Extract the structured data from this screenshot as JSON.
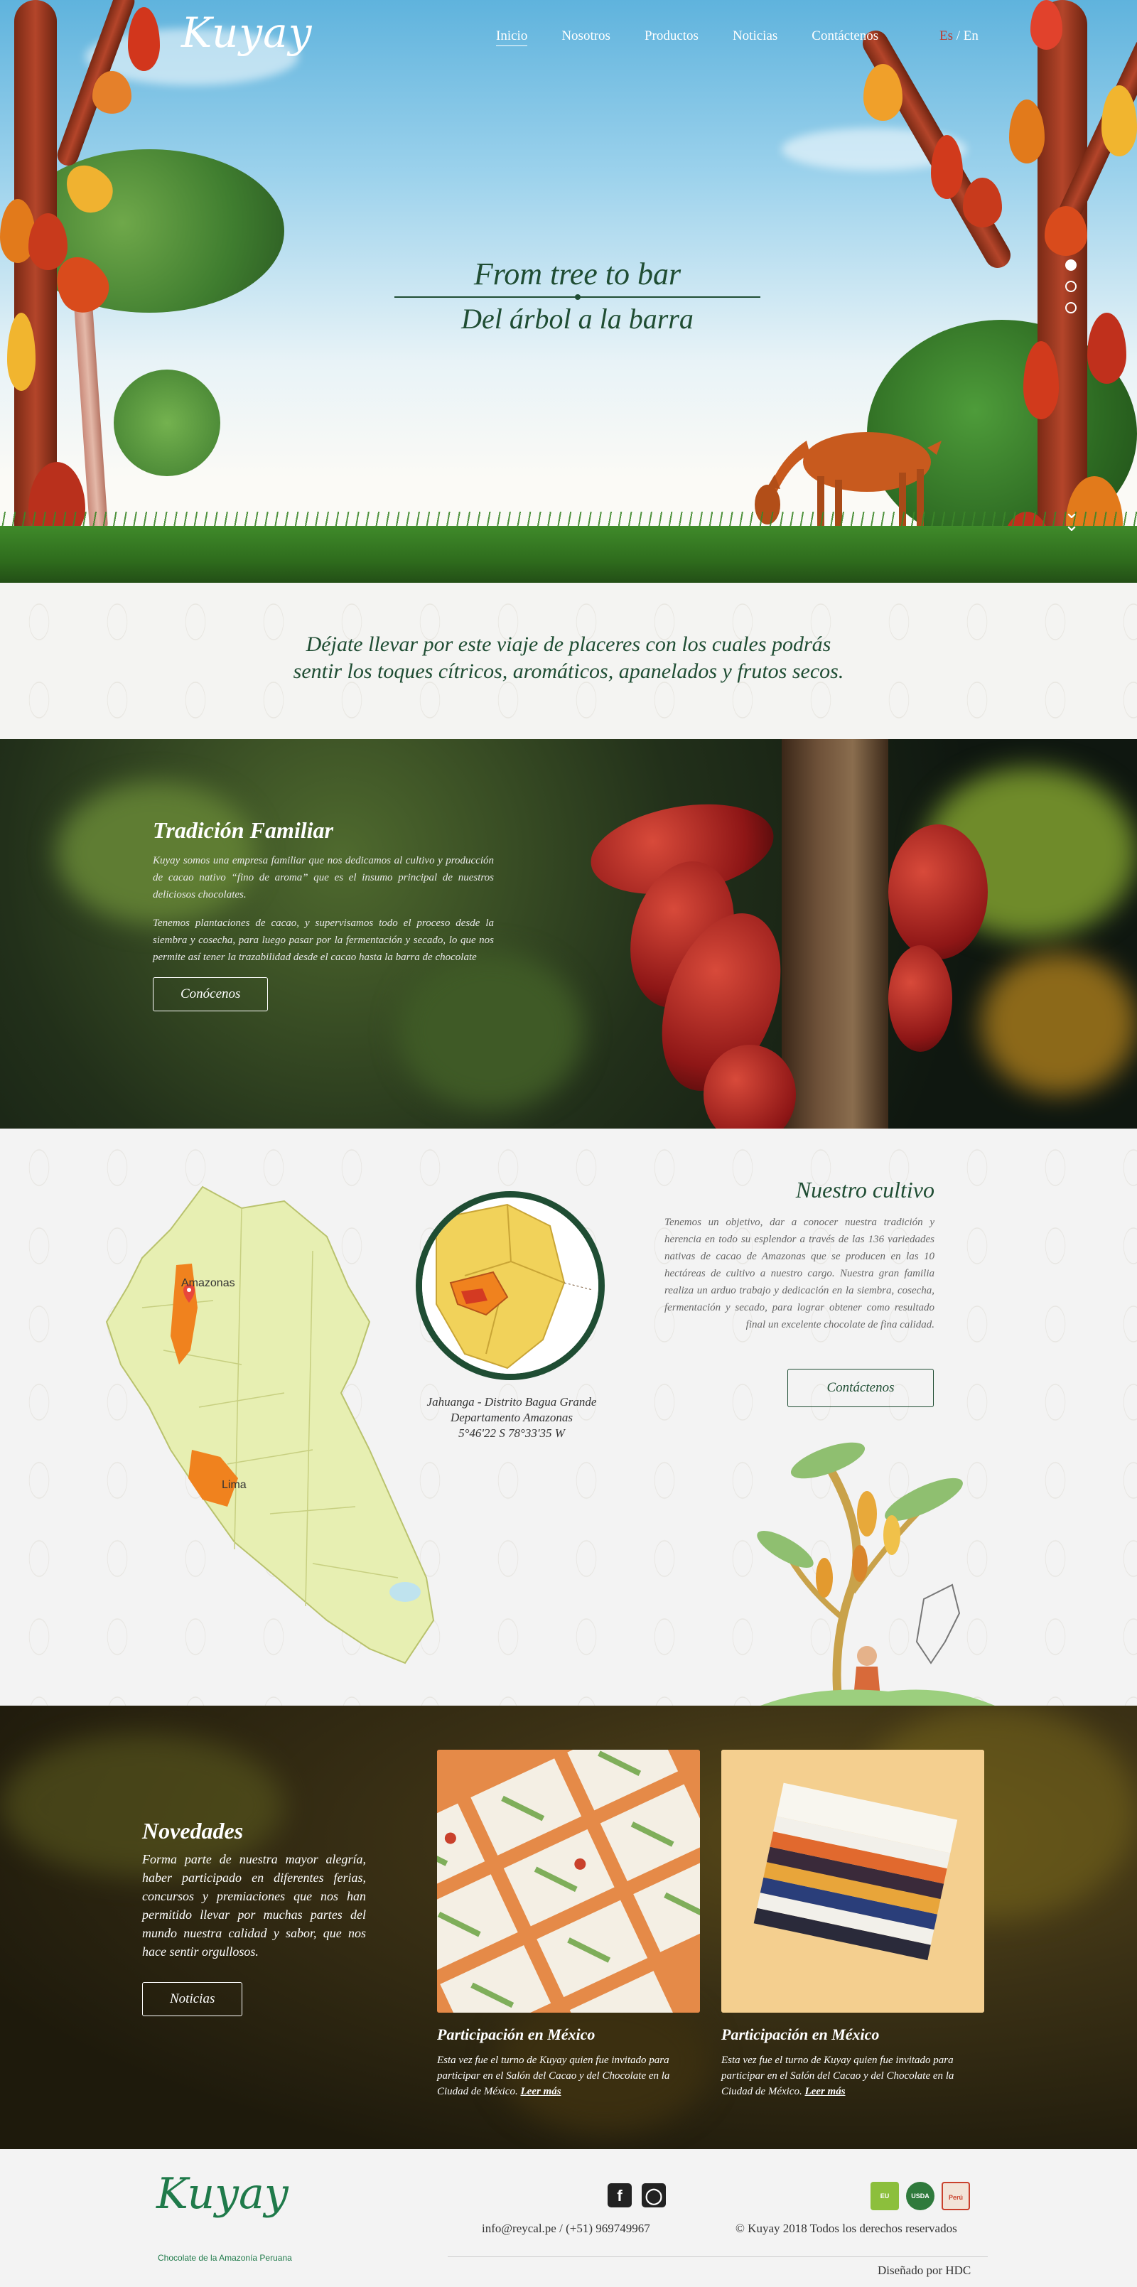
{
  "nav": {
    "logo": "Kuyay",
    "items": [
      "Inicio",
      "Nosotros",
      "Productos",
      "Noticias",
      "Contáctenos"
    ],
    "lang_es": "Es",
    "lang_sep": " / ",
    "lang_en": "En"
  },
  "hero": {
    "line1": "From tree to bar",
    "line2": "Del árbol a la barra",
    "slides_total": 3,
    "active_slide": 1
  },
  "intro": {
    "line1": "Déjate llevar por este viaje de placeres con los cuales podrás",
    "line2": "sentir los toques cítricos, aromáticos, apanelados y frutos secos."
  },
  "tradicion": {
    "title": "Tradición Familiar",
    "p1": "Kuyay somos una empresa familiar que nos dedicamos al cultivo y producción de cacao nativo “fino de aroma” que es el insumo principal de nuestros deliciosos chocolates.",
    "p2": "Tenemos plantaciones de cacao, y supervisamos todo el proceso desde la siembra y cosecha, para luego pasar por la fermentación y secado, lo que nos permite así tener la trazabilidad desde el cacao hasta la barra de chocolate",
    "button": "Conócenos"
  },
  "cultivo": {
    "map_label_amazonas": "Amazonas",
    "map_label_lima": "Lima",
    "loc_line1": "Jahuanga - Distrito Bagua Grande",
    "loc_line2": "Departamento Amazonas",
    "loc_line3": "5°46'22 S 78°33'35 W",
    "title": "Nuestro cultivo",
    "text": "Tenemos un objetivo, dar a conocer nuestra tradición y herencia en todo su esplendor a través de las 136 variedades nativas de cacao de Amazonas que se producen en las 10 hectáreas de cultivo a nuestro cargo. Nuestra gran familia realiza un arduo trabajo y dedicación en la siembra, cosecha, fermentación y secado, para lograr obtener como resultado final un excelente chocolate de fina calidad.",
    "button": "Contáctenos"
  },
  "novedades": {
    "title": "Novedades",
    "text": "Forma parte de nuestra mayor alegría, haber participado en diferentes ferias, concursos y premiaciones que nos han permitido llevar por muchas partes del mundo nuestra calidad y sabor, que nos hace sentir orgullosos.",
    "button": "Noticias",
    "cards": [
      {
        "title": "Participación en México",
        "text": "Esta vez fue el turno de Kuyay quien fue invitado para participar en el Salón del Cacao y del Chocolate en la Ciudad de México.",
        "link": "Leer más"
      },
      {
        "title": "Participación en México",
        "text": "Esta vez fue el turno de Kuyay quien fue invitado para participar en el Salón del Cacao y del Chocolate en la Ciudad de México.",
        "link": "Leer más"
      }
    ]
  },
  "footer": {
    "logo": "Kuyay",
    "tagline": "Chocolate de la Amazonía Peruana",
    "social": [
      "facebook-icon",
      "instagram-icon"
    ],
    "contact": "info@reycal.pe / (+51) 969749967",
    "copyright": "© Kuyay 2018 Todos los derechos reservados",
    "designed_by": "Diseñado por HDC"
  },
  "colors": {
    "brand_green": "#1f4d33",
    "logo_green": "#1f7a4a",
    "map_fill": "#e7efb2",
    "map_highlight": "#f0821e"
  }
}
